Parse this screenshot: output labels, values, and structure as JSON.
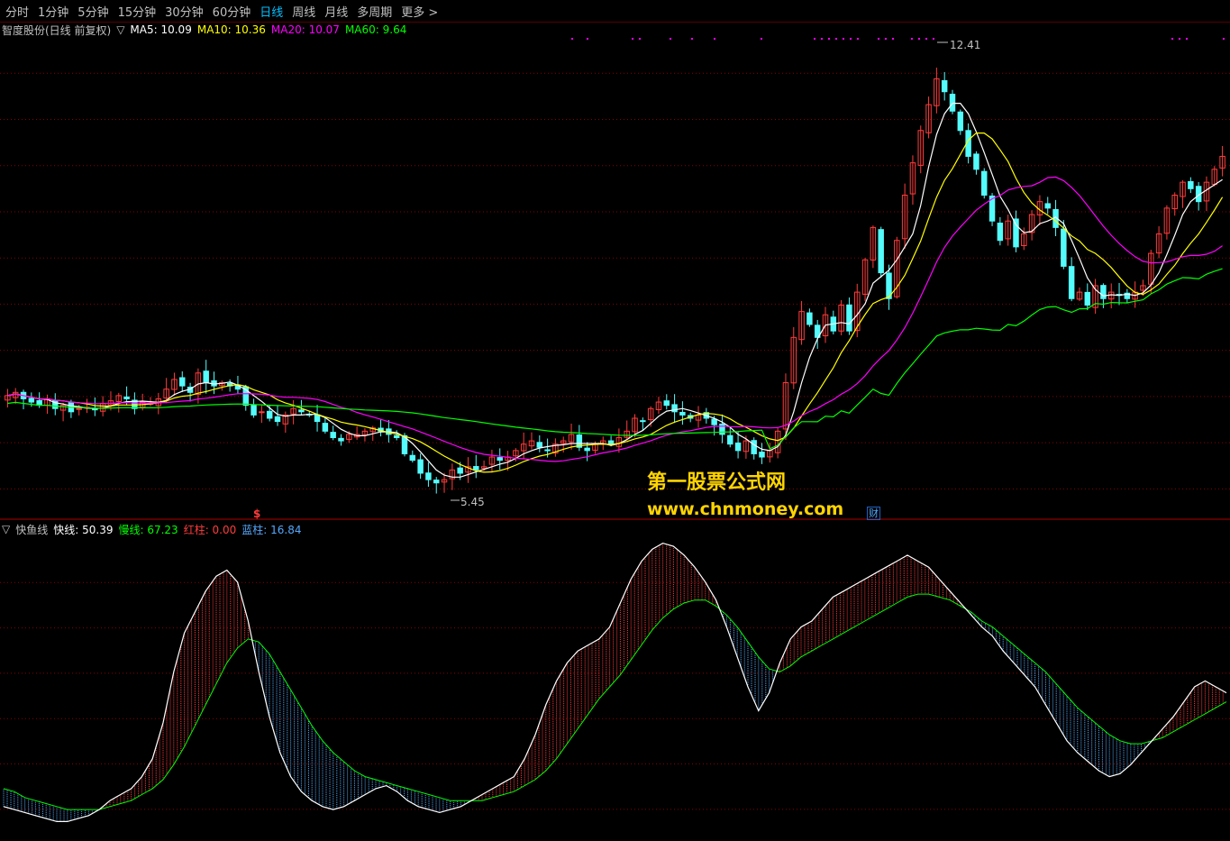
{
  "toolbar": {
    "tabs": [
      "分时",
      "1分钟",
      "5分钟",
      "15分钟",
      "30分钟",
      "60分钟",
      "日线",
      "周线",
      "月线",
      "多周期",
      "更多"
    ],
    "active": "日线",
    "more_glyph": ">"
  },
  "colors": {
    "up": "#ff3c3c",
    "down": "#54fcfc",
    "ma5": "#ffffff",
    "ma10": "#ffff00",
    "ma20": "#ff00ff",
    "ma60": "#00ff00",
    "grid": "#8b0000",
    "fast": "#ffffff",
    "slow": "#00ff00",
    "red_bar": "#ff3c3c",
    "blue_bar": "#54a8fc",
    "signal": "#ff00ff",
    "watermark": "#ffd400"
  },
  "main": {
    "title": "智度股份(日线 前复权)",
    "toggle": "▽",
    "ma5_label": "MA5: 10.09",
    "ma10_label": "MA10: 10.36",
    "ma20_label": "MA20: 10.07",
    "ma60_label": "MA60: 9.64",
    "high_label": "12.41",
    "low_label": "5.45",
    "dollar_marker": "$",
    "finance_marker": "财"
  },
  "indicator": {
    "toggle": "▽",
    "name": "快鱼线",
    "fast_label": "快线: 50.39",
    "slow_label": "慢线: 67.23",
    "red_label": "红柱: 0.00",
    "blue_label": "蓝柱: 16.84"
  },
  "watermark": {
    "line1": "第一股票公式网",
    "line2": "www.chnmoney.com"
  },
  "chart_data": [
    {
      "type": "candlestick",
      "title": "智度股份(日线 前复权)",
      "ylim": [
        5.1,
        12.6
      ],
      "price_series": [
        6.9,
        6.95,
        6.85,
        6.8,
        6.75,
        6.85,
        6.7,
        6.75,
        6.65,
        6.7,
        6.72,
        6.68,
        6.78,
        6.82,
        6.9,
        6.85,
        6.7,
        6.8,
        6.78,
        6.85,
        7.0,
        7.15,
        7.05,
        6.95,
        7.25,
        7.1,
        7.05,
        7.1,
        7.05,
        7.0,
        6.75,
        6.6,
        6.65,
        6.55,
        6.5,
        6.6,
        6.7,
        6.65,
        6.6,
        6.5,
        6.35,
        6.25,
        6.2,
        6.3,
        6.3,
        6.35,
        6.4,
        6.35,
        6.3,
        6.25,
        6.0,
        5.9,
        5.7,
        5.6,
        5.55,
        5.6,
        5.75,
        5.7,
        5.8,
        5.75,
        5.8,
        5.95,
        5.9,
        5.95,
        6.05,
        6.15,
        6.2,
        6.1,
        6.05,
        6.15,
        6.2,
        6.3,
        6.1,
        6.05,
        6.15,
        6.2,
        6.15,
        6.25,
        6.35,
        6.55,
        6.5,
        6.7,
        6.8,
        6.75,
        6.65,
        6.6,
        6.55,
        6.6,
        6.55,
        6.45,
        6.3,
        6.15,
        6.05,
        6.2,
        6.0,
        5.95,
        6.05,
        6.35,
        7.1,
        7.8,
        8.2,
        8.0,
        7.8,
        8.15,
        7.9,
        8.3,
        7.9,
        8.5,
        9.0,
        9.5,
        8.8,
        8.4,
        9.3,
        10.0,
        10.5,
        11.0,
        11.4,
        11.8,
        11.6,
        11.3,
        11.0,
        10.6,
        10.4,
        10.0,
        9.6,
        9.3,
        9.6,
        9.2,
        9.4,
        9.7,
        9.9,
        9.8,
        9.5,
        8.9,
        8.4,
        8.5,
        8.3,
        8.6,
        8.4,
        8.5,
        8.45,
        8.4,
        8.5,
        8.6,
        9.1,
        9.4,
        9.8,
        10.0,
        10.2,
        10.1,
        9.9,
        10.2,
        10.4,
        10.6
      ],
      "ma5_last": 10.09,
      "ma10_last": 10.36,
      "ma20_last": 10.07,
      "ma60_last": 9.64,
      "high": 12.41,
      "low": 5.45
    },
    {
      "type": "line",
      "title": "快鱼线",
      "ylim": [
        0,
        100
      ],
      "fast": [
        10,
        9,
        8,
        7,
        6,
        5,
        5,
        6,
        7,
        9,
        12,
        14,
        16,
        20,
        26,
        38,
        55,
        68,
        75,
        82,
        87,
        89,
        85,
        72,
        55,
        40,
        28,
        20,
        15,
        12,
        10,
        9,
        10,
        12,
        14,
        16,
        17,
        15,
        12,
        10,
        9,
        8,
        9,
        10,
        12,
        14,
        16,
        18,
        20,
        26,
        34,
        44,
        52,
        58,
        62,
        64,
        66,
        70,
        78,
        86,
        92,
        96,
        98,
        97,
        94,
        90,
        85,
        79,
        70,
        60,
        50,
        42,
        48,
        58,
        66,
        70,
        72,
        76,
        80,
        82,
        84,
        86,
        88,
        90,
        92,
        94,
        92,
        90,
        86,
        82,
        78,
        74,
        70,
        67,
        62,
        58,
        54,
        50,
        44,
        38,
        32,
        28,
        25,
        22,
        20,
        21,
        24,
        28,
        32,
        36,
        40,
        45,
        50,
        52,
        50,
        48
      ],
      "slow": [
        16,
        15,
        13,
        12,
        11,
        10,
        9,
        9,
        9,
        9,
        10,
        11,
        12,
        14,
        16,
        19,
        24,
        30,
        37,
        44,
        51,
        58,
        63,
        66,
        65,
        61,
        55,
        49,
        43,
        37,
        32,
        28,
        25,
        22,
        20,
        19,
        18,
        17,
        16,
        15,
        14,
        13,
        12,
        12,
        12,
        12,
        13,
        14,
        15,
        17,
        19,
        22,
        26,
        31,
        36,
        41,
        46,
        50,
        54,
        59,
        64,
        69,
        73,
        76,
        78,
        79,
        79,
        77,
        74,
        70,
        65,
        60,
        56,
        55,
        57,
        60,
        62,
        64,
        66,
        68,
        70,
        72,
        74,
        76,
        78,
        80,
        81,
        81,
        80,
        79,
        77,
        75,
        72,
        70,
        67,
        64,
        61,
        58,
        55,
        51,
        47,
        43,
        40,
        37,
        34,
        32,
        31,
        31,
        32,
        33,
        35,
        37,
        39,
        41,
        43,
        45
      ]
    }
  ]
}
